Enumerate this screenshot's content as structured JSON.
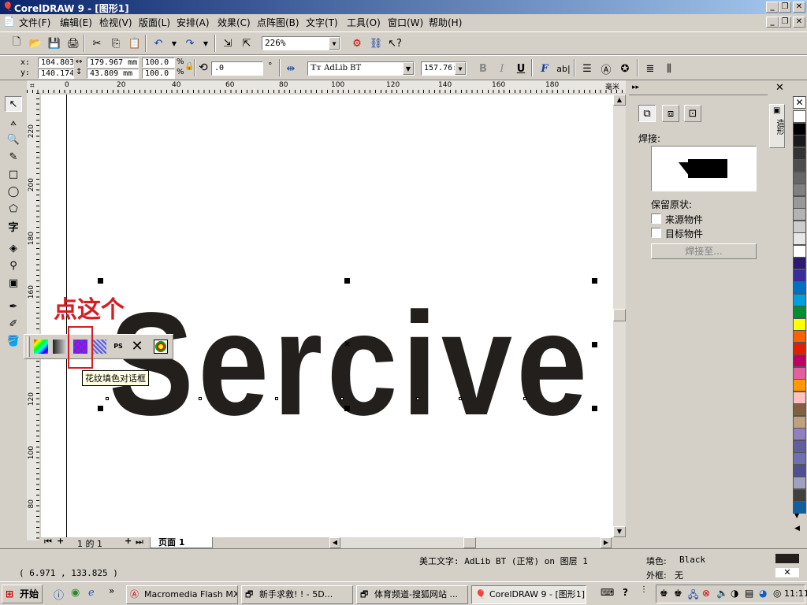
{
  "window": {
    "title": "CorelDRAW 9 - [图形1]"
  },
  "menu": [
    "文件(F)",
    "编辑(E)",
    "检视(V)",
    "版面(L)",
    "安排(A)",
    "效果(C)",
    "点阵图(B)",
    "文字(T)",
    "工具(O)",
    "窗口(W)",
    "帮助(H)"
  ],
  "toolbar": {
    "zoom": "226%"
  },
  "propbar": {
    "x_label": "x:",
    "x": "104.803",
    "y_label": "y:",
    "y": "140.174",
    "w": "179.967 mm",
    "h": "43.809 mm",
    "sx": "100.0",
    "sy": "100.0",
    "pct": "%",
    "angle": ".0",
    "deg": "°",
    "font": "AdLib BT",
    "size": "157.76:",
    "bold": "B",
    "italic": "I",
    "underline": "U"
  },
  "ruler": {
    "h_ticks": [
      "0",
      "20",
      "40",
      "60",
      "80",
      "100",
      "120",
      "140",
      "160",
      "180"
    ],
    "h_unit": "毫米",
    "v_ticks": [
      "220",
      "200",
      "180",
      "160",
      "140",
      "120",
      "100",
      "80"
    ]
  },
  "canvas": {
    "artistic_text": "Sercive"
  },
  "annotation": {
    "text": "点这个"
  },
  "tooltip": {
    "text": "花纹填色对话框"
  },
  "pagenav": {
    "page_info": "1 的 1",
    "page_tab": "页面 1"
  },
  "docker": {
    "weld_label": "焊接:",
    "keep_original": "保留原状:",
    "source_object": "来源物件",
    "target_object": "目标物件",
    "weld_button": "焊接至...",
    "side_tab": "造形"
  },
  "status": {
    "coords": "( 6.971 , 133.825 )",
    "object_info": "美工文字: AdLib BT (正常) on 图层 1",
    "fill_label": "填色:",
    "fill_value": "Black",
    "outline_label": "外框:",
    "outline_value": "无"
  },
  "taskbar": {
    "start": "开始",
    "tasks": [
      "Macromedia Flash MX...",
      "新手求救! ! - 5D...",
      "体育频道-搜狐网站 ...",
      "CorelDRAW 9 - [图形1]"
    ],
    "clock": "11:11"
  },
  "palette_colors": [
    "#ffffff",
    "#000000",
    "#1a1a1a",
    "#333333",
    "#4d4d4d",
    "#666666",
    "#808080",
    "#999999",
    "#b3b3b3",
    "#cccccc",
    "#e6e6e6",
    "#ffffff",
    "#2e1a6e",
    "#3a2c9a",
    "#0070c0",
    "#00a0e0",
    "#009030",
    "#ffff00",
    "#ff6000",
    "#e02000",
    "#c00060",
    "#e060a0",
    "#ff9900",
    "#ffc0c0",
    "#806040",
    "#c0a080",
    "#9080c0",
    "#6060a0",
    "#7070b0",
    "#505090",
    "#a0a0c0",
    "#404040",
    "#1060a0"
  ],
  "colors": {
    "text_fill": "#231f1c",
    "annotation": "#d41e24",
    "title_start": "#0a246a",
    "title_end": "#a6caf0"
  }
}
